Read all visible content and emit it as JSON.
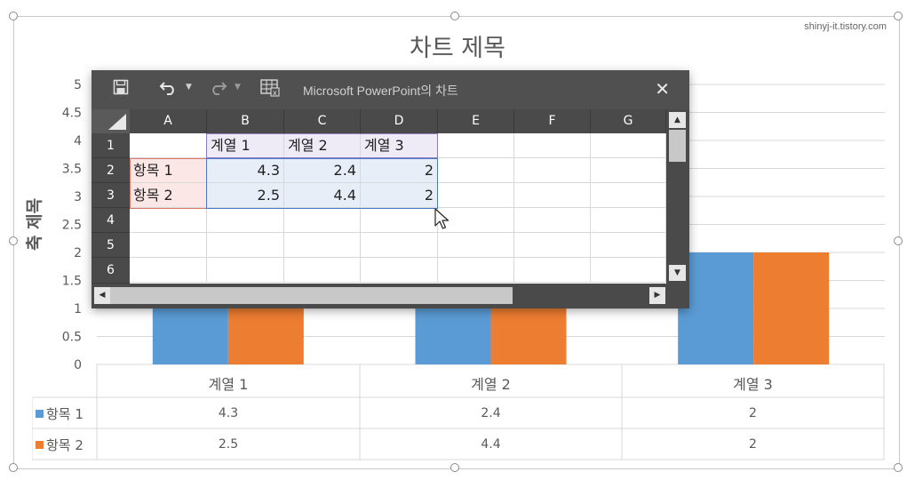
{
  "watermark": "shinyj-it.tistory.com",
  "chart": {
    "title": "차트 제목",
    "ylabel": "축 제목"
  },
  "chart_data": {
    "type": "bar",
    "title": "차트 제목",
    "ylabel": "축 제목",
    "xlabel": "",
    "categories": [
      "계열 1",
      "계열 2",
      "계열 3"
    ],
    "series": [
      {
        "name": "항목 1",
        "values": [
          4.3,
          2.4,
          2
        ],
        "color": "#5b9bd5"
      },
      {
        "name": "항목 2",
        "values": [
          2.5,
          4.4,
          2
        ],
        "color": "#ed7d31"
      }
    ],
    "ylim": [
      0,
      5
    ],
    "yticks": [
      "0",
      "0.5",
      "1",
      "1.5",
      "2",
      "2.5",
      "3",
      "3.5",
      "4",
      "4.5",
      "5"
    ],
    "grid": true,
    "legend": "data-table"
  },
  "data_table": {
    "headers": [
      "계열 1",
      "계열 2",
      "계열 3"
    ],
    "rows": [
      {
        "label": "항목 1",
        "values": [
          "4.3",
          "2.4",
          "2"
        ],
        "color": "#5b9bd5"
      },
      {
        "label": "항목 2",
        "values": [
          "2.5",
          "4.4",
          "2"
        ],
        "color": "#ed7d31"
      }
    ]
  },
  "excel": {
    "title": "Microsoft PowerPoint의 차트",
    "icons": {
      "save": "save-icon",
      "undo": "undo-icon",
      "redo": "redo-icon",
      "edit_data": "edit-data-icon",
      "close": "close-icon"
    },
    "columns": [
      "A",
      "B",
      "C",
      "D",
      "E",
      "F",
      "G"
    ],
    "rows": [
      "1",
      "2",
      "3",
      "4",
      "5",
      "6"
    ],
    "cells": {
      "B1": "계열 1",
      "C1": "계열 2",
      "D1": "계열 3",
      "A2": "항목 1",
      "B2": "4.3",
      "C2": "2.4",
      "D2": "2",
      "A3": "항목 2",
      "B3": "2.5",
      "C3": "4.4",
      "D3": "2"
    }
  }
}
